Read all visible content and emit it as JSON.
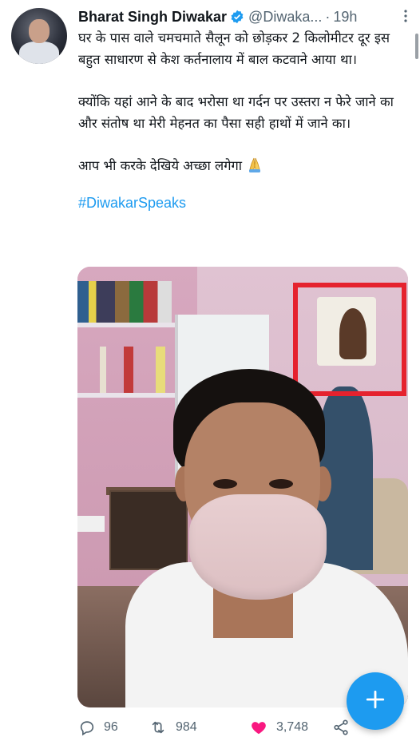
{
  "tweet": {
    "author_name": "Bharat Singh Diwakar",
    "handle": "@Diwaka...",
    "separator": "·",
    "time": "19h",
    "paragraphs": [
      "घर के पास वाले चमचमाते सैलून को छोड़कर 2 किलोमीटर दूर इस बहुत साधारण से केश कर्तनालाय में बाल कटवाने आया था।",
      "क्योंकि यहां आने के बाद भरोसा था गर्दन पर उस्तरा न फेरे जाने का और संतोष था मेरी मेहनत का पैसा सही हाथों में जाने का।",
      "आप भी करके देखिये अच्छा लगेगा"
    ],
    "hashtag": "#DiwakarSpeaks"
  },
  "actions": {
    "replies": "96",
    "retweets": "984",
    "likes": "3,748"
  },
  "fab": {
    "icon": "plus-icon"
  },
  "colors": {
    "accent": "#1d9bf0",
    "like": "#f91880",
    "highlight_box": "#e5222e",
    "muted_text": "#536471"
  }
}
